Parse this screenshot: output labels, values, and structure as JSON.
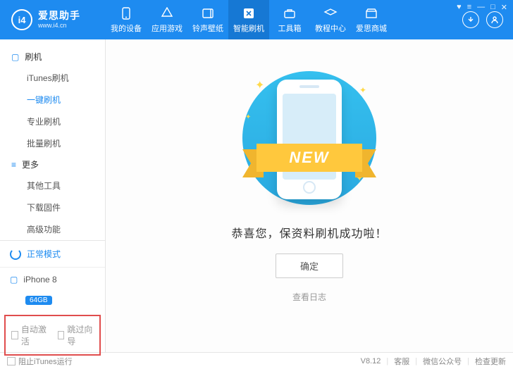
{
  "app": {
    "name": "爱思助手",
    "site": "www.i4.cn",
    "logo_text": "i4"
  },
  "nav": {
    "items": [
      {
        "label": "我的设备"
      },
      {
        "label": "应用游戏"
      },
      {
        "label": "铃声壁纸"
      },
      {
        "label": "智能刷机"
      },
      {
        "label": "工具箱"
      },
      {
        "label": "教程中心"
      },
      {
        "label": "爱思商城"
      }
    ]
  },
  "sidebar": {
    "section_flash": "刷机",
    "section_more": "更多",
    "flash_items": [
      {
        "label": "iTunes刷机"
      },
      {
        "label": "一键刷机"
      },
      {
        "label": "专业刷机"
      },
      {
        "label": "批量刷机"
      }
    ],
    "more_items": [
      {
        "label": "其他工具"
      },
      {
        "label": "下载固件"
      },
      {
        "label": "高级功能"
      }
    ],
    "mode": "正常模式",
    "device_name": "iPhone 8",
    "device_capacity": "64GB",
    "auto_activate": "自动激活",
    "skip_guide": "跳过向导"
  },
  "main": {
    "ribbon_text": "NEW",
    "success_text": "恭喜您，保资料刷机成功啦！",
    "ok": "确定",
    "view_log": "查看日志"
  },
  "footer": {
    "block_itunes": "阻止iTunes运行",
    "version": "V8.12",
    "support": "客服",
    "wechat": "微信公众号",
    "check_update": "检查更新"
  }
}
